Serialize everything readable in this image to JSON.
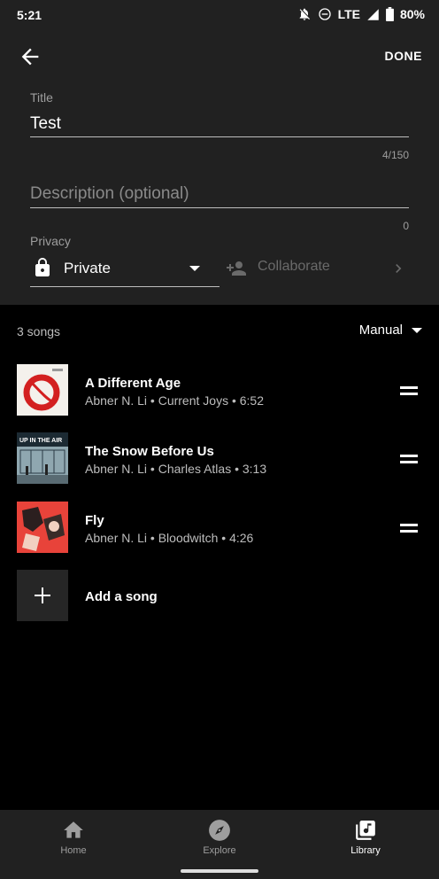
{
  "status": {
    "time": "5:21",
    "network": "LTE",
    "battery": "80%"
  },
  "header": {
    "done_label": "DONE"
  },
  "form": {
    "title_label": "Title",
    "title_value": "Test",
    "title_counter": "4/150",
    "description_placeholder": "Description (optional)",
    "description_counter": "0",
    "privacy_label": "Privacy",
    "privacy_value": "Private",
    "collaborate_label": "Collaborate"
  },
  "list": {
    "count": "3 songs",
    "sort": "Manual",
    "songs": [
      {
        "title": "A Different Age",
        "subtitle": "Abner N. Li • Current Joys • 6:52",
        "art_text": ""
      },
      {
        "title": "The Snow Before Us",
        "subtitle": "Abner N. Li • Charles Atlas • 3:13",
        "art_text": "UP IN THE AIR"
      },
      {
        "title": "Fly",
        "subtitle": "Abner N. Li • Bloodwitch • 4:26",
        "art_text": ""
      }
    ],
    "add_label": "Add a song"
  },
  "nav": {
    "items": [
      {
        "label": "Home"
      },
      {
        "label": "Explore"
      },
      {
        "label": "Library"
      }
    ]
  },
  "colors": {
    "panel": "#212121",
    "background": "#000000",
    "accent": "#ffffff",
    "muted": "#9e9e9e"
  },
  "icons": [
    "back-arrow-icon",
    "lock-icon",
    "add-person-icon",
    "chevron-right-icon",
    "drag-handle-icon",
    "plus-icon",
    "home-icon",
    "compass-icon",
    "library-icon"
  ]
}
